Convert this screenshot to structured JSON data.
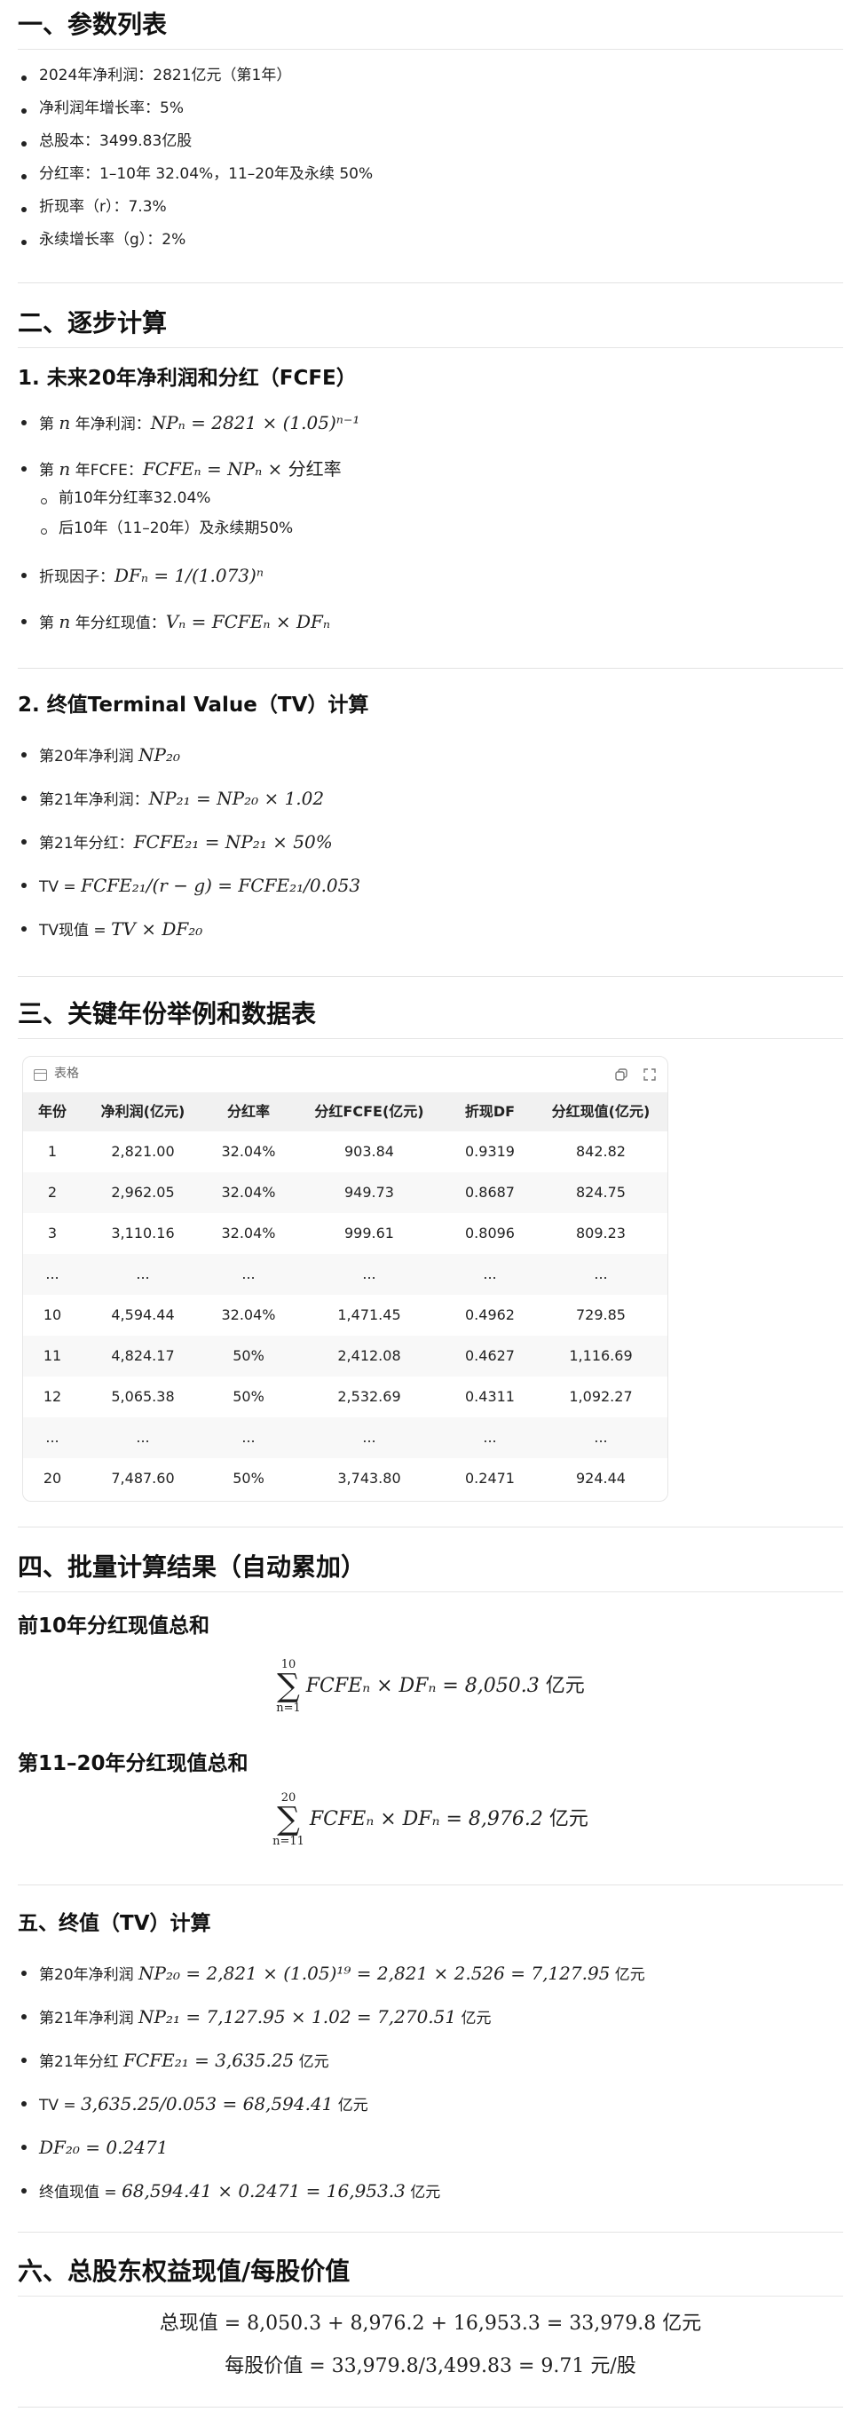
{
  "section1": {
    "title": "一、参数列表",
    "items": [
      "2024年净利润：2821亿元（第1年）",
      "净利润年增长率：5%",
      "总股本：3499.83亿股",
      "分红率：1–10年 32.04%，11–20年及永续 50%",
      "折现率（r）：7.3%",
      "永续增长率（g）：2%"
    ]
  },
  "section2": {
    "title": "二、逐步计算",
    "sub1_title": "1. 未来20年净利润和分红（FCFE）",
    "b1_label": "第",
    "b1_n": "n",
    "b1_text": "年净利润：",
    "b1_math": "NPₙ = 2821 × (1.05)ⁿ⁻¹",
    "b2_label": "第",
    "b2_n": "n",
    "b2_text": "年FCFE：",
    "b2_math": "FCFEₙ = NPₙ × ",
    "b2_math_cn": "分红率",
    "b2_sub1": "前10年分红率32.04%",
    "b2_sub2": "后10年（11–20年）及永续期50%",
    "b3_text": "折现因子：",
    "b3_math": "DFₙ = 1/(1.073)ⁿ",
    "b4_label": "第",
    "b4_n": "n",
    "b4_text": "年分红现值：",
    "b4_math": "Vₙ = FCFEₙ × DFₙ",
    "sub2_title": "2. 终值Terminal Value（TV）计算",
    "t1_text": "第20年净利润 ",
    "t1_math": "NP₂₀",
    "t2_text": "第21年净利润：",
    "t2_math": "NP₂₁ = NP₂₀ × 1.02",
    "t3_text": "第21年分红：",
    "t3_math": "FCFE₂₁ = NP₂₁ × 50%",
    "t4_text": "TV = ",
    "t4_math": "FCFE₂₁/(r − g) = FCFE₂₁/0.053",
    "t5_text": "TV现值 = ",
    "t5_math": "TV × DF₂₀"
  },
  "section3": {
    "title": "三、关键年份举例和数据表",
    "table_label": "表格",
    "copy_icon": "copy-icon",
    "expand_icon": "expand-icon",
    "headers": [
      "年份",
      "净利润(亿元)",
      "分红率",
      "分红FCFE(亿元)",
      "折现DF",
      "分红现值(亿元)"
    ],
    "rows": [
      [
        "1",
        "2,821.00",
        "32.04%",
        "903.84",
        "0.9319",
        "842.82"
      ],
      [
        "2",
        "2,962.05",
        "32.04%",
        "949.73",
        "0.8687",
        "824.75"
      ],
      [
        "3",
        "3,110.16",
        "32.04%",
        "999.61",
        "0.8096",
        "809.23"
      ],
      [
        "...",
        "...",
        "...",
        "...",
        "...",
        "..."
      ],
      [
        "10",
        "4,594.44",
        "32.04%",
        "1,471.45",
        "0.4962",
        "729.85"
      ],
      [
        "11",
        "4,824.17",
        "50%",
        "2,412.08",
        "0.4627",
        "1,116.69"
      ],
      [
        "12",
        "5,065.38",
        "50%",
        "2,532.69",
        "0.4311",
        "1,092.27"
      ],
      [
        "...",
        "...",
        "...",
        "...",
        "...",
        "..."
      ],
      [
        "20",
        "7,487.60",
        "50%",
        "3,743.80",
        "0.2471",
        "924.44"
      ]
    ]
  },
  "section4": {
    "title": "四、批量计算结果（自动累加）",
    "sub1_title": "前10年分红现值总和",
    "sum1_top": "10",
    "sum1_bot": "n=1",
    "sum1_expr": "FCFEₙ × DFₙ = 8,050.3 ",
    "sum1_unit": "亿元",
    "sub2_title": "第11–20年分红现值总和",
    "sum2_top": "20",
    "sum2_bot": "n=11",
    "sum2_expr": "FCFEₙ × DFₙ = 8,976.2 ",
    "sum2_unit": "亿元"
  },
  "section5": {
    "title": "五、终值（TV）计算",
    "l1_text": "第20年净利润 ",
    "l1_math": "NP₂₀ = 2,821 × (1.05)¹⁹ = 2,821 × 2.526 = 7,127.95",
    "l1_unit": " 亿元",
    "l2_text": "第21年净利润 ",
    "l2_math": "NP₂₁ = 7,127.95 × 1.02 = 7,270.51",
    "l2_unit": " 亿元",
    "l3_text": "第21年分红 ",
    "l3_math": "FCFE₂₁ = 3,635.25",
    "l3_unit": " 亿元",
    "l4_text": "TV = ",
    "l4_math": "3,635.25/0.053 = 68,594.41",
    "l4_unit": " 亿元",
    "l5_math": "DF₂₀ = 0.2471",
    "l6_text": "终值现值 = ",
    "l6_math": "68,594.41 × 0.2471 = 16,953.3",
    "l6_unit": " 亿元"
  },
  "section6": {
    "title": "六、总股东权益现值/每股价值",
    "line1_cn": "总现值",
    "line1_math": " = 8,050.3 + 8,976.2 + 16,953.3 = 33,979.8 ",
    "line1_unit": "亿元",
    "line2_cn": "每股价值",
    "line2_math": " = 33,979.8/3,499.83 = 9.71 ",
    "line2_unit": "元/股"
  }
}
